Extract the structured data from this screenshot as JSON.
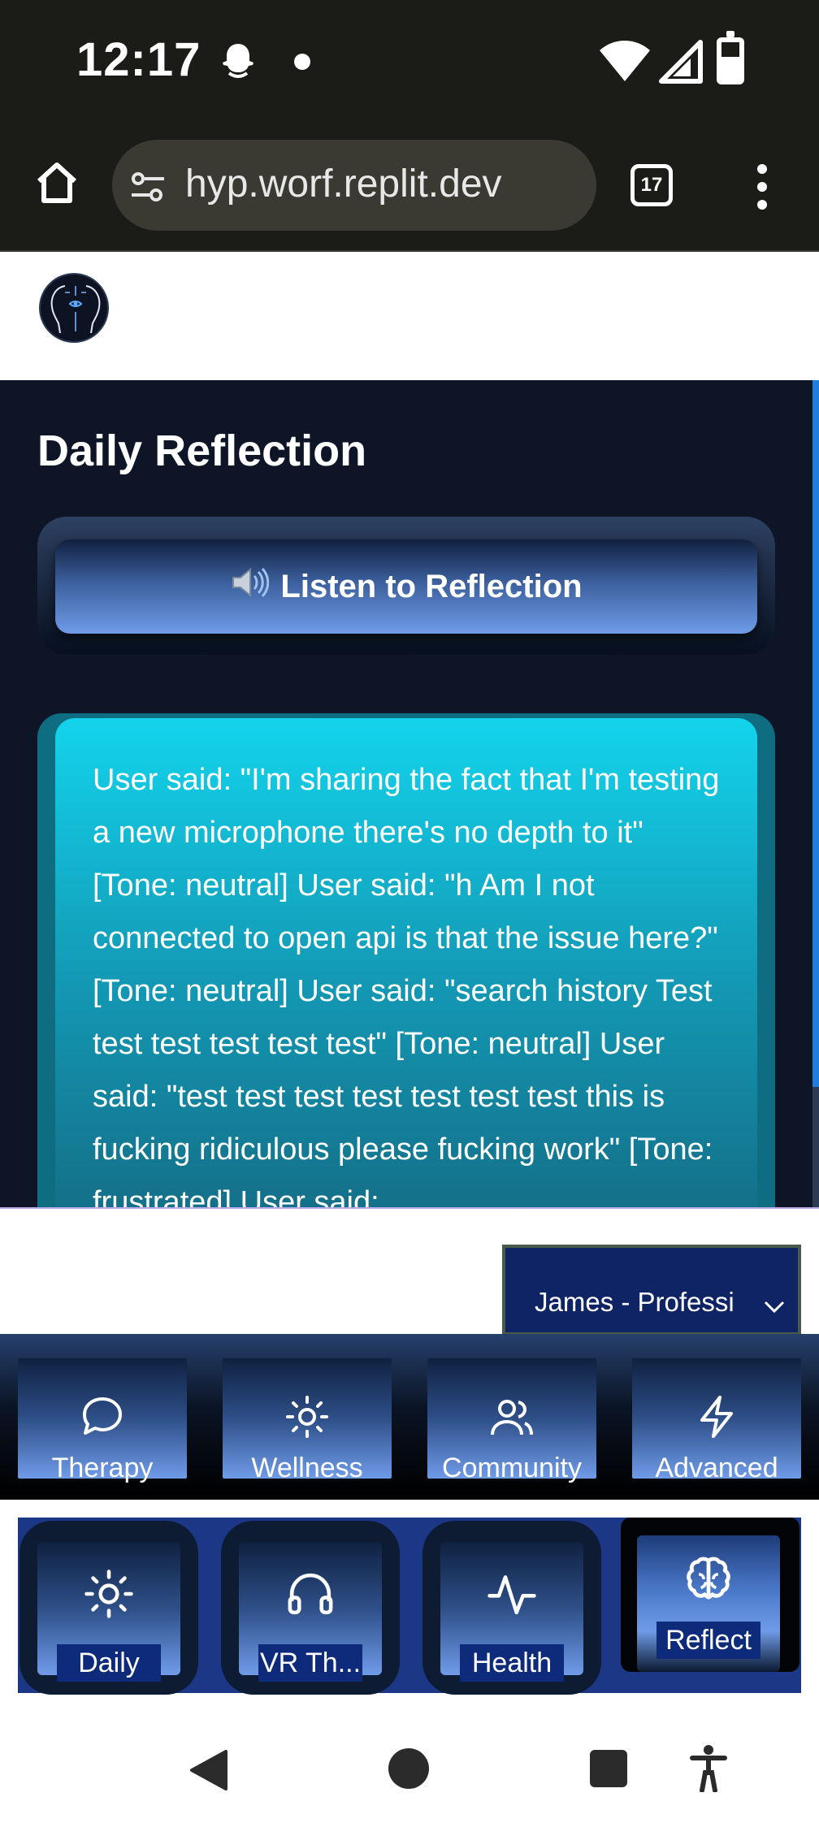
{
  "status_bar": {
    "time": "12:17"
  },
  "browser": {
    "url": "hyp.worf.replit.dev",
    "tab_count": "17"
  },
  "page": {
    "title": "Daily Reflection",
    "listen_button": "Listen to Reflection",
    "reflection_text": "User said: \"I'm sharing the fact that I'm testing a new microphone there's no depth to it\" [Tone: neutral] User said: \"h Am I not connected to open api is that the issue here?\" [Tone: neutral] User said: \"search history Test test test test test test\" [Tone: neutral] User said: \"test test test test test test test this is fucking ridiculous please fucking work\" [Tone: frustrated] User said:"
  },
  "coach_select": {
    "value": "James - Professi"
  },
  "category_nav": [
    {
      "label": "Therapy",
      "icon": "chat-bubble-icon"
    },
    {
      "label": "Wellness",
      "icon": "sun-icon"
    },
    {
      "label": "Community",
      "icon": "users-icon"
    },
    {
      "label": "Advanced",
      "icon": "lightning-icon"
    }
  ],
  "bottom_tabs": [
    {
      "label": "Daily",
      "icon": "sun-icon"
    },
    {
      "label": "VR Th...",
      "icon": "headphones-icon"
    },
    {
      "label": "Health",
      "icon": "activity-icon"
    },
    {
      "label": "Reflect",
      "icon": "brain-icon",
      "active": true
    }
  ],
  "colors": {
    "accent_blue": "#6f9be8",
    "card_cyan": "#13d4ec",
    "page_dark": "#0d1527",
    "tabbar_blue": "#1b3786"
  }
}
